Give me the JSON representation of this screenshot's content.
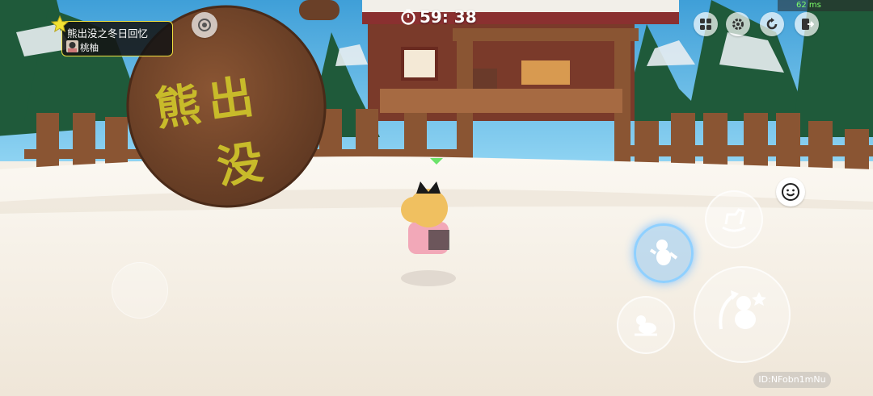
{
  "hud": {
    "map_title": "熊出没之冬日回忆",
    "author_name": "桃柚",
    "timer": "59: 38",
    "ping": "62 ms",
    "player_id": "ID:NFobn1mNu"
  },
  "scene": {
    "sign_text_line1": "熊出",
    "sign_text_line2": "没"
  },
  "icons": {
    "top_left": "camera-icon",
    "timer": "stopwatch-icon",
    "menu": "grid-menu-icon",
    "settings": "gear-icon",
    "reset": "refresh-icon",
    "exit": "exit-icon",
    "emote": "smiley-face-icon"
  },
  "colors": {
    "sky": "#5ab6e6",
    "snow": "#f4efe6",
    "wood": "#7a4a2a",
    "sign_text": "#c8bb2a",
    "card_border": "#f0e040",
    "ping_text": "#7dff6a",
    "highlight_ring": "#8fd0ff"
  }
}
